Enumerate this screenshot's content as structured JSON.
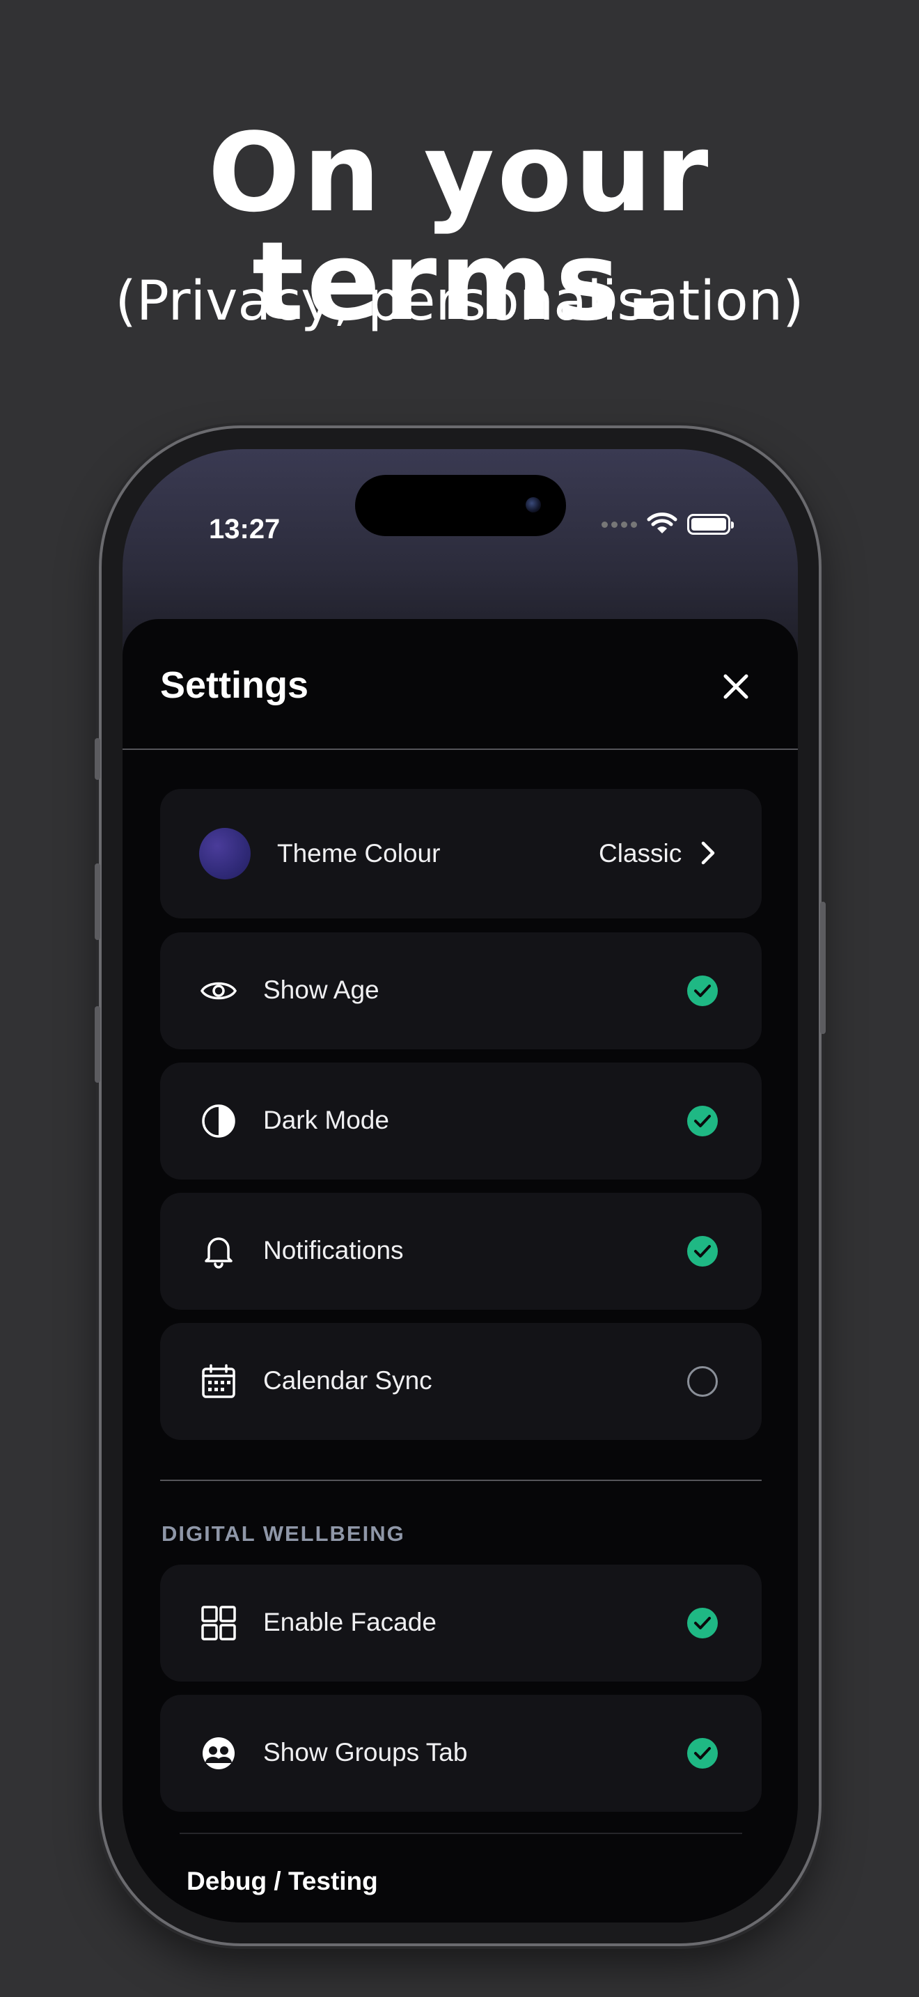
{
  "promo": {
    "headline": "On your terms.",
    "subheadline": "(Privacy, personalisation)"
  },
  "statusbar": {
    "time": "13:27",
    "icons": [
      "signal-dots-icon",
      "wifi-icon",
      "battery-icon"
    ]
  },
  "sheet": {
    "title": "Settings",
    "close_icon": "close-icon",
    "theme": {
      "label": "Theme Colour",
      "value": "Classic",
      "swatch_color": "#332b7e"
    },
    "settings": [
      {
        "label": "Show Age",
        "icon": "eye-icon",
        "enabled": true
      },
      {
        "label": "Dark Mode",
        "icon": "contrast-icon",
        "enabled": true
      },
      {
        "label": "Notifications",
        "icon": "bell-icon",
        "enabled": true
      },
      {
        "label": "Calendar Sync",
        "icon": "calendar-icon",
        "enabled": false
      }
    ],
    "wellbeing": {
      "section_label": "DIGITAL WELLBEING",
      "items": [
        {
          "label": "Enable Facade",
          "icon": "grid-icon",
          "enabled": true
        },
        {
          "label": "Show Groups Tab",
          "icon": "group-icon",
          "enabled": true
        }
      ]
    },
    "debug_title": "Debug / Testing"
  },
  "colors": {
    "background": "#323234",
    "sheet": "#060608",
    "card": "#131317",
    "accent_check": "#1fb884",
    "section_label": "#8f97a8"
  }
}
